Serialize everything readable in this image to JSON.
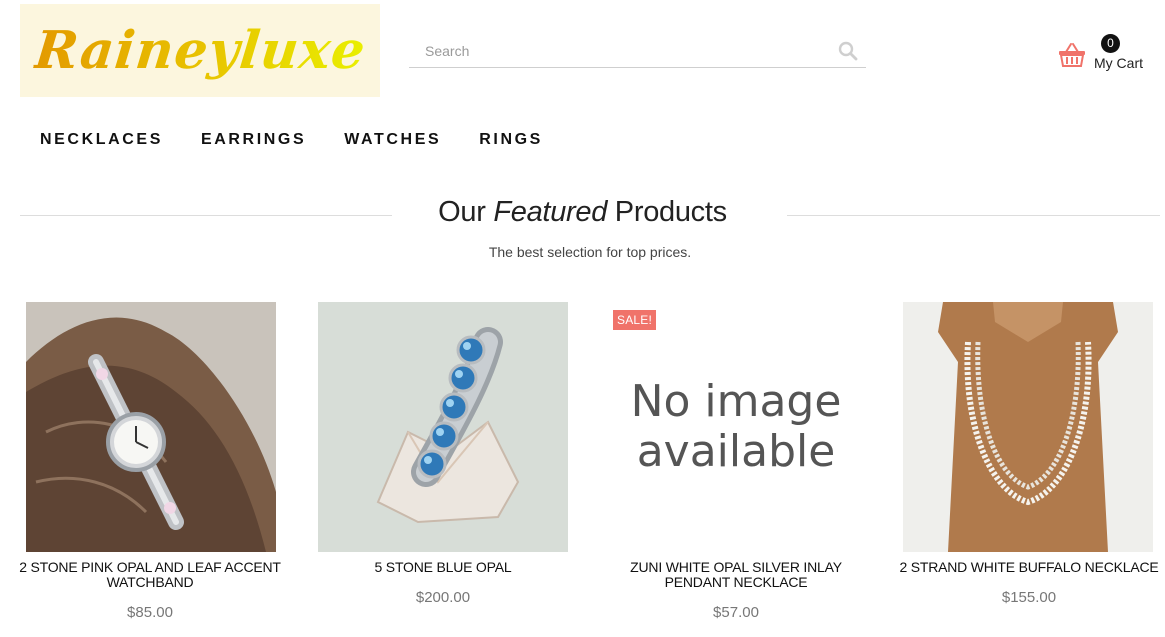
{
  "header": {
    "logo_text": "Raineyluxe",
    "search_placeholder": "Search",
    "cart_count": "0",
    "cart_label": "My Cart"
  },
  "nav": {
    "items": [
      {
        "label": "NECKLACES"
      },
      {
        "label": "EARRINGS"
      },
      {
        "label": "WATCHES"
      },
      {
        "label": "RINGS"
      }
    ]
  },
  "section": {
    "title_part1": "Our",
    "title_part2": "Featured",
    "title_part3": "Products",
    "subtitle": "The best selection for top prices."
  },
  "products": [
    {
      "name": "2 STONE PINK OPAL AND LEAF ACCENT WATCHBAND",
      "price": "$85.00"
    },
    {
      "name": "5 STONE BLUE OPAL",
      "price": "$200.00"
    },
    {
      "name": "ZUNI WHITE OPAL SILVER INLAY PENDANT NECKLACE",
      "price": "$57.00",
      "badge": "SALE!",
      "placeholder_text": "No image available"
    },
    {
      "name": "2 STRAND WHITE BUFFALO NECKLACE",
      "price": "$155.00"
    }
  ],
  "colors": {
    "accent": "#f0736a",
    "logo_gold": "#e39a00",
    "logo_yellow": "#e9ef00",
    "logo_bg": "#fcf6de"
  },
  "icons": {
    "search": "search-icon",
    "cart": "shopping-basket-icon"
  }
}
